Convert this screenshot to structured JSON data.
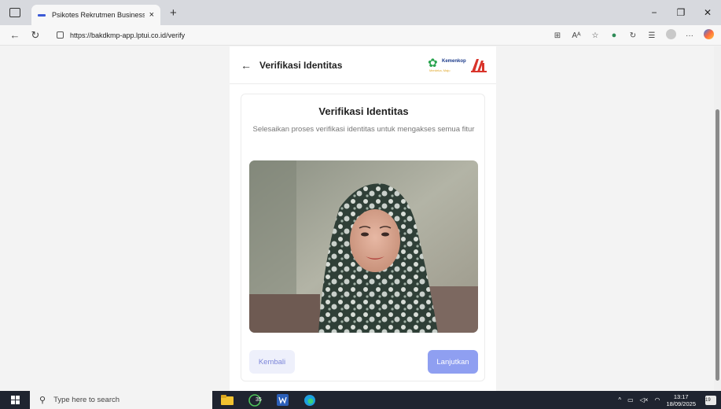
{
  "browser": {
    "tab_title": "Psikotes Rekrutmen Business Ass",
    "tab_close": "×",
    "new_tab": "+",
    "url": "https://bakdkmp-app.lptui.co.id/verify",
    "window_controls": {
      "minimize": "−",
      "restore": "❐",
      "close": "✕"
    },
    "nav": {
      "back": "←",
      "reload": "↻"
    },
    "tools": [
      "read-aloud",
      "text-size",
      "favorite",
      "extension",
      "refresh-ext",
      "favorites",
      "profile",
      "more",
      "copilot"
    ]
  },
  "header": {
    "back": "←",
    "title": "Verifikasi Identitas",
    "logo_brand": "Kemenkop",
    "logo_tag": "Merdeka, Maju"
  },
  "card": {
    "title": "Verifikasi Identitas",
    "subtitle": "Selesaikan proses verifikasi identitas untuk mengakses semua fitur",
    "back_button": "Kembali",
    "next_button": "Lanjutkan"
  },
  "taskbar": {
    "search_placeholder": "Type here to search",
    "whatsapp_badge": "35",
    "time": "13:17",
    "date": "18/09/2025",
    "notification_count": "19"
  },
  "colors": {
    "primary_button": "#8f9ff1",
    "secondary_button": "#eef0fb",
    "secondary_text": "#7c86d9"
  }
}
